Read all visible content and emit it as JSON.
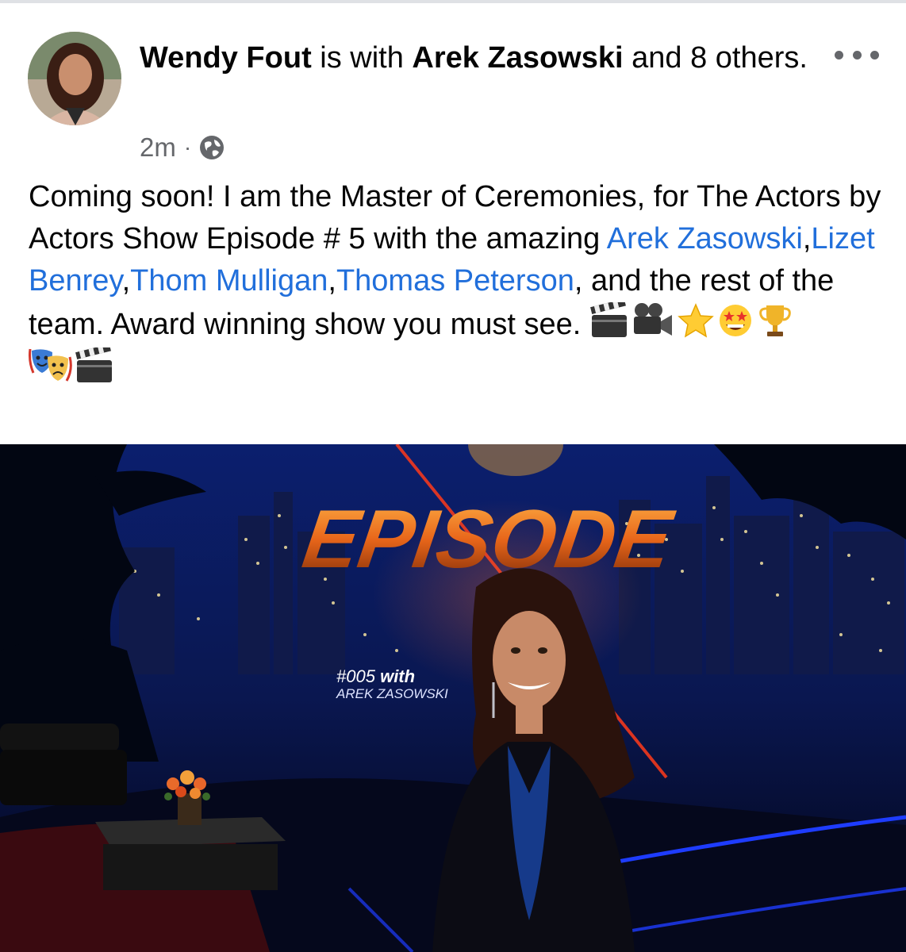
{
  "post": {
    "author": "Wendy Fout",
    "with_text": " is with ",
    "tagged_main": "Arek Zasowski",
    "and_text": " and ",
    "others_link": "8 others",
    "period": ".",
    "timestamp": "2m",
    "separator": "·",
    "privacy_icon": "globe-icon",
    "more_icon": "more-options-icon",
    "text_part1": "Coming soon! I am the Master of Ceremonies,  for The Actors by Actors Show Episode # 5 with the amazing ",
    "mentions": [
      "Arek Zasowski",
      "Lizet Benrey",
      "Thom Mulligan",
      "Thomas Peterson"
    ],
    "comma": ",",
    "text_part2": ", and the rest of the team. Award winning show you must see. ",
    "emoji_icons": [
      "clapper-board-icon",
      "movie-camera-icon",
      "star-icon",
      "star-struck-face-icon",
      "trophy-icon",
      "theater-masks-icon",
      "clapper-board-icon"
    ]
  },
  "media": {
    "title_word": "EPISODE",
    "episode_number": "5",
    "caption_line1_a": "#005",
    "caption_line1_b": "with",
    "caption_line2": "AREK ZASOWSKI",
    "colors": {
      "sky": "#0a1a5c",
      "fire": "#e8661a",
      "stage_blue": "#1e3cff"
    }
  }
}
